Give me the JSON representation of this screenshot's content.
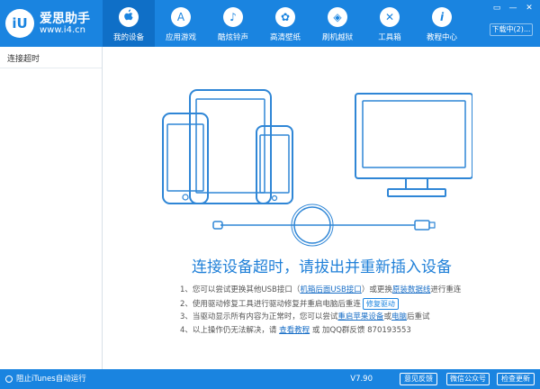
{
  "brand": {
    "mark": "iU",
    "name": "爱思助手",
    "url": "www.i4.cn"
  },
  "nav": [
    {
      "label": "我的设备",
      "icon": "apple-icon",
      "glyph": ""
    },
    {
      "label": "应用游戏",
      "icon": "appstore-icon",
      "glyph": "A"
    },
    {
      "label": "酷炫铃声",
      "icon": "bell-icon",
      "glyph": "♪"
    },
    {
      "label": "高清壁纸",
      "icon": "flower-icon",
      "glyph": "✿"
    },
    {
      "label": "刷机越狱",
      "icon": "dropbox-icon",
      "glyph": "◈"
    },
    {
      "label": "工具箱",
      "icon": "tools-icon",
      "glyph": "✕"
    },
    {
      "label": "教程中心",
      "icon": "info-icon",
      "glyph": "i"
    }
  ],
  "window_controls": {
    "menu": "▭",
    "minimize": "—",
    "close": "✕"
  },
  "download_label": "下载中(2)...",
  "sidebar": {
    "items": [
      {
        "label": "连接超时"
      }
    ]
  },
  "main": {
    "headline": "连接设备超时，请拔出并重新插入设备",
    "tips": {
      "t1_a": "1、您可以尝试更换其他USB接口（",
      "t1_link1": "机箱后面USB接口",
      "t1_b": "）或更换",
      "t1_link2": "原装数据线",
      "t1_c": "进行重连",
      "t2_a": "2、使用驱动修复工具进行驱动修复并重启电脑后重连",
      "t2_btn": "修复驱动",
      "t3_a": "3、当驱动显示所有内容为正常时，您可以尝试",
      "t3_link1": "重启苹果设备",
      "t3_b": "或",
      "t3_link2": "电脑",
      "t3_c": "后重试",
      "t4_a": "4、以上操作仍无法解决，请 ",
      "t4_link": "查看教程",
      "t4_b": " 或 加QQ群反馈 870193553"
    }
  },
  "statusbar": {
    "itunes_label": "阻止iTunes自动运行",
    "version": "V7.90",
    "feedback": "意见反馈",
    "wechat": "微信公众号",
    "update": "检查更新"
  },
  "colors": {
    "primary": "#1a84e0",
    "nav_active": "#0f6fc7",
    "line_art": "#2f86d6"
  }
}
